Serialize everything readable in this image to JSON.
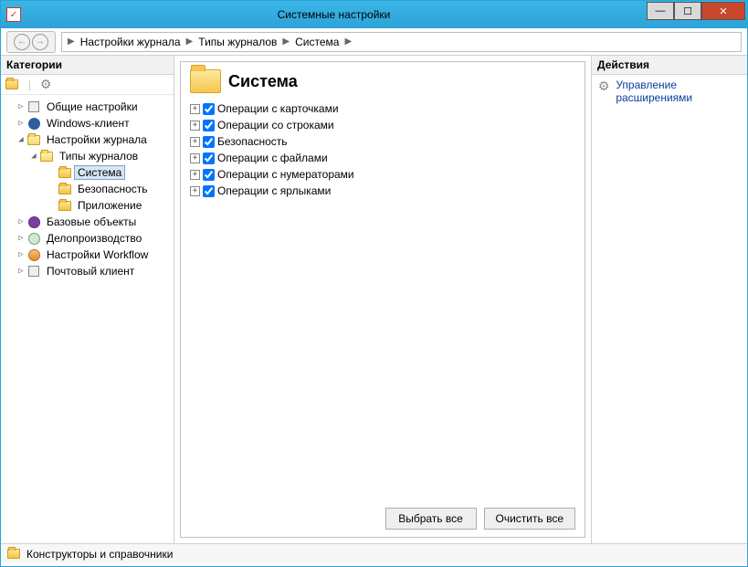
{
  "window": {
    "title": "Системные настройки"
  },
  "breadcrumb": {
    "items": [
      "Настройки журнала",
      "Типы журналов",
      "Система"
    ]
  },
  "left": {
    "header": "Категории",
    "tree": [
      {
        "label": "Общие настройки",
        "depth": 1,
        "expander": "▷",
        "icon": "sq"
      },
      {
        "label": "Windows-клиент",
        "depth": 1,
        "expander": "▷",
        "icon": "circle-blue"
      },
      {
        "label": "Настройки журнала",
        "depth": 1,
        "expander": "◢",
        "icon": "folder-open"
      },
      {
        "label": "Типы журналов",
        "depth": 2,
        "expander": "◢",
        "icon": "folder-open"
      },
      {
        "label": "Система",
        "depth": 3,
        "expander": "",
        "icon": "folder",
        "selected": true
      },
      {
        "label": "Безопасность",
        "depth": 3,
        "expander": "",
        "icon": "folder"
      },
      {
        "label": "Приложение",
        "depth": 3,
        "expander": "",
        "icon": "folder"
      },
      {
        "label": "Базовые объекты",
        "depth": 1,
        "expander": "▷",
        "icon": "circle-purple"
      },
      {
        "label": "Делопроизводство",
        "depth": 1,
        "expander": "▷",
        "icon": "circle-teal"
      },
      {
        "label": "Настройки Workflow",
        "depth": 1,
        "expander": "▷",
        "icon": "circle-orange"
      },
      {
        "label": "Почтовый клиент",
        "depth": 1,
        "expander": "▷",
        "icon": "sq"
      }
    ]
  },
  "center": {
    "title": "Система",
    "items": [
      {
        "label": "Операции с карточками",
        "checked": true
      },
      {
        "label": "Операции со строками",
        "checked": true
      },
      {
        "label": "Безопасность",
        "checked": true
      },
      {
        "label": "Операции с файлами",
        "checked": true
      },
      {
        "label": "Операции с нумераторами",
        "checked": true
      },
      {
        "label": "Операции с ярлыками",
        "checked": true
      }
    ],
    "buttons": {
      "select_all": "Выбрать все",
      "clear_all": "Очистить все"
    }
  },
  "right": {
    "header": "Действия",
    "link": "Управление расширениями"
  },
  "status": {
    "text": "Конструкторы и справочники"
  }
}
